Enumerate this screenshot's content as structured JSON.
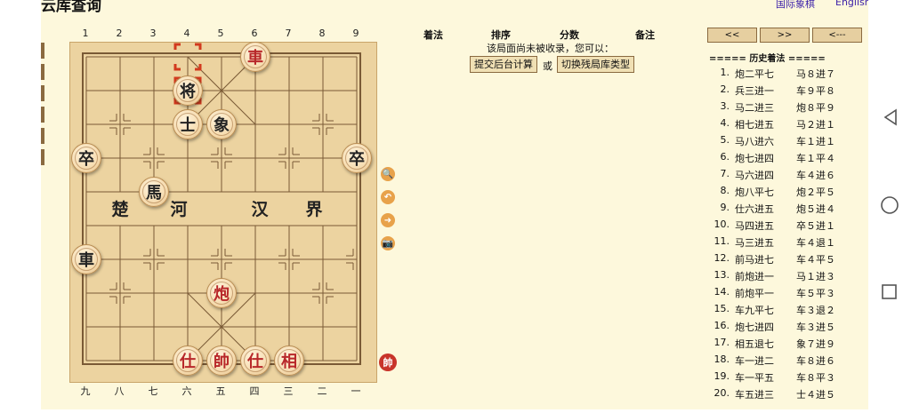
{
  "app": {
    "title": "云库查询",
    "link_intl": "国际象棋",
    "link_en": "English"
  },
  "board": {
    "top_coords": [
      "1",
      "2",
      "3",
      "4",
      "5",
      "6",
      "7",
      "8",
      "9"
    ],
    "bottom_coords": [
      "九",
      "八",
      "七",
      "六",
      "五",
      "四",
      "三",
      "二",
      "一"
    ],
    "river_left": [
      "楚",
      "河"
    ],
    "river_right": [
      "汉",
      "界"
    ],
    "pieces": [
      {
        "char": "車",
        "color": "red",
        "col": 5,
        "row": 0
      },
      {
        "char": "将",
        "color": "black",
        "col": 3,
        "row": 1
      },
      {
        "char": "士",
        "color": "black",
        "col": 3,
        "row": 2
      },
      {
        "char": "象",
        "color": "black",
        "col": 4,
        "row": 2
      },
      {
        "char": "卒",
        "color": "black",
        "col": 0,
        "row": 3
      },
      {
        "char": "卒",
        "color": "black",
        "col": 8,
        "row": 3
      },
      {
        "char": "馬",
        "color": "black",
        "col": 2,
        "row": 4
      },
      {
        "char": "車",
        "color": "black",
        "col": 0,
        "row": 6
      },
      {
        "char": "炮",
        "color": "red",
        "col": 4,
        "row": 7
      },
      {
        "char": "仕",
        "color": "red",
        "col": 3,
        "row": 9
      },
      {
        "char": "帥",
        "color": "red",
        "col": 4,
        "row": 9
      },
      {
        "char": "仕",
        "color": "red",
        "col": 5,
        "row": 9
      },
      {
        "char": "相",
        "color": "red",
        "col": 6,
        "row": 9
      }
    ],
    "turn_badge": "帥"
  },
  "tools": [
    "🔍",
    "↶",
    "➜",
    "📷"
  ],
  "table_headers": [
    "着法",
    "排序",
    "分数",
    "备注"
  ],
  "message": "该局面尚未被收录，您可以：",
  "buttons": {
    "submit": "提交后台计算",
    "or": "或",
    "switch": "切换残局库类型"
  },
  "nav": [
    "<<",
    ">>",
    "<---"
  ],
  "history_title": "===== 历史着法 =====",
  "history": [
    {
      "n": "1.",
      "r": "炮二平七",
      "b": "马８进７"
    },
    {
      "n": "2.",
      "r": "兵三进一",
      "b": "车９平８"
    },
    {
      "n": "3.",
      "r": "马二进三",
      "b": "炮８平９"
    },
    {
      "n": "4.",
      "r": "相七进五",
      "b": "马２进１"
    },
    {
      "n": "5.",
      "r": "马八进六",
      "b": "车１进１"
    },
    {
      "n": "6.",
      "r": "炮七进四",
      "b": "车１平４"
    },
    {
      "n": "7.",
      "r": "马六进四",
      "b": "车４进６"
    },
    {
      "n": "8.",
      "r": "炮八平七",
      "b": "炮２平５"
    },
    {
      "n": "9.",
      "r": "仕六进五",
      "b": "炮５进４"
    },
    {
      "n": "10.",
      "r": "马四进五",
      "b": "卒５进１"
    },
    {
      "n": "11.",
      "r": "马三进五",
      "b": "车４退１"
    },
    {
      "n": "12.",
      "r": "前马进七",
      "b": "车４平５"
    },
    {
      "n": "13.",
      "r": "前炮进一",
      "b": "马１进３"
    },
    {
      "n": "14.",
      "r": "前炮平一",
      "b": "车５平３"
    },
    {
      "n": "15.",
      "r": "车九平七",
      "b": "车３退２"
    },
    {
      "n": "16.",
      "r": "炮七进四",
      "b": "车３进５"
    },
    {
      "n": "17.",
      "r": "相五退七",
      "b": "象７进９"
    },
    {
      "n": "18.",
      "r": "车一进二",
      "b": "车８进６"
    },
    {
      "n": "19.",
      "r": "车一平五",
      "b": "车８平３"
    },
    {
      "n": "20.",
      "r": "车五进三",
      "b": "士４进５"
    }
  ],
  "colors": {
    "red_piece": "#b8282a",
    "board": "#ecd3a0",
    "page_bg": "#fdf8dc",
    "marker": "#d23a1e"
  }
}
